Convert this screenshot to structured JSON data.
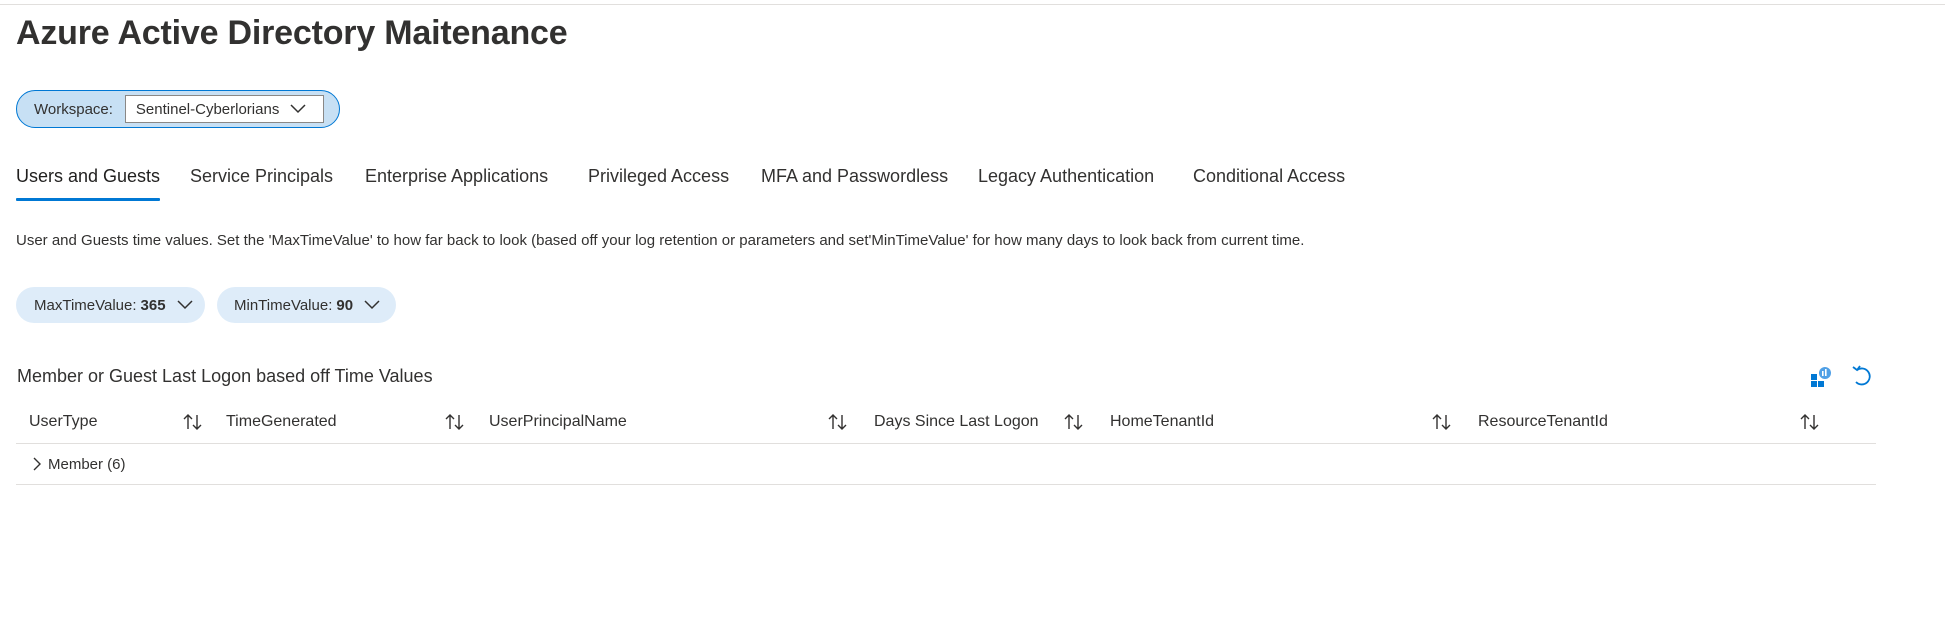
{
  "page": {
    "title": "Azure Active Directory Maitenance"
  },
  "workspace": {
    "label": "Workspace:",
    "value": "Sentinel-Cyberlorians"
  },
  "tabs": [
    {
      "label": "Users and Guests",
      "active": true
    },
    {
      "label": "Service Principals",
      "active": false
    },
    {
      "label": "Enterprise Applications",
      "active": false
    },
    {
      "label": "Privileged Access",
      "active": false
    },
    {
      "label": "MFA and Passwordless",
      "active": false
    },
    {
      "label": "Legacy Authentication",
      "active": false
    },
    {
      "label": "Conditional Access",
      "active": false
    }
  ],
  "description": "User and Guests time values. Set the 'MaxTimeValue' to how far back to look (based off your log retention or parameters and set'MinTimeValue' for how many days to look back from current time.",
  "parameters": [
    {
      "label": "MaxTimeValue:",
      "value": "365"
    },
    {
      "label": "MinTimeValue:",
      "value": "90"
    }
  ],
  "section": {
    "title": "Member or Guest Last Logon based off Time Values",
    "toolbar": [
      "open-in-logs-icon",
      "refresh-icon"
    ]
  },
  "grid": {
    "columns": [
      "UserType",
      "TimeGenerated",
      "UserPrincipalName",
      "Days Since Last Logon",
      "HomeTenantId",
      "ResourceTenantId"
    ],
    "groups": [
      {
        "label": "Member (6)",
        "expanded": false
      }
    ]
  },
  "colors": {
    "accent": "#0078d4",
    "pill_bg": "#c7e0f4",
    "param_bg": "#deecf9",
    "text": "#323130",
    "divider": "#e1dfdd"
  }
}
